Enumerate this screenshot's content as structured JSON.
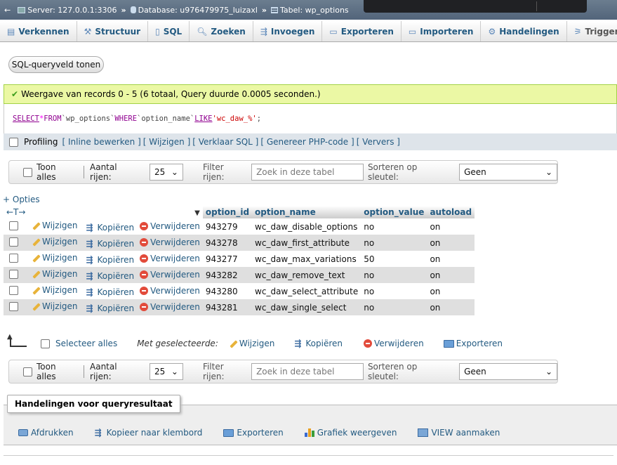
{
  "breadcrumb": {
    "back": "←",
    "server": "Server: 127.0.0.1:3306",
    "database": "Database: u976479975_luizaxl",
    "table": "Tabel: wp_options",
    "separator": "»"
  },
  "tabs": [
    {
      "label": "Verkennen",
      "icon": "browse-icon"
    },
    {
      "label": "Structuur",
      "icon": "structure-icon"
    },
    {
      "label": "SQL",
      "icon": "sql-icon"
    },
    {
      "label": "Zoeken",
      "icon": "search-icon"
    },
    {
      "label": "Invoegen",
      "icon": "insert-icon"
    },
    {
      "label": "Exporteren",
      "icon": "export-icon"
    },
    {
      "label": "Importeren",
      "icon": "import-icon"
    },
    {
      "label": "Handelingen",
      "icon": "wrench-icon"
    },
    {
      "label": "Triggers",
      "icon": "triggers-icon"
    }
  ],
  "sql_button": "SQL-queryveld tonen",
  "success_message": "Weergave van records 0 - 5 (6 totaal, Query duurde 0.0005 seconden.)",
  "query": {
    "select": "SELECT",
    "star": "*",
    "from": "FROM",
    "table": "`wp_options`",
    "where": "WHERE",
    "column": "`option_name`",
    "like": "LIKE",
    "value": "'wc_daw_%'",
    "end": ";"
  },
  "profiling": {
    "label": "Profiling",
    "links": [
      "[ Inline bewerken ]",
      "[ Wijzigen ]",
      "[ Verklaar SQL ]",
      "[ Genereer PHP-code ]",
      "[ Ververs ]"
    ]
  },
  "navbar": {
    "show_all": "Toon alles",
    "rows_label": "Aantal rijen:",
    "rows_value": "25",
    "filter_label": "Filter rijen:",
    "filter_placeholder": "Zoek in deze tabel",
    "sort_label": "Sorteren op sleutel:",
    "sort_value": "Geen"
  },
  "options_link": "+ Opties",
  "column_arrows": "←T→",
  "columns": {
    "sort_indicator": "▼",
    "id": "option_id",
    "name": "option_name",
    "value": "option_value",
    "autoload": "autoload"
  },
  "row_actions": {
    "edit": "Wijzigen",
    "copy": "Kopiëren",
    "delete": "Verwijderen"
  },
  "rows": [
    {
      "id": "943279",
      "name": "wc_daw_disable_options",
      "value": "no",
      "autoload": "on"
    },
    {
      "id": "943278",
      "name": "wc_daw_first_attribute",
      "value": "no",
      "autoload": "on"
    },
    {
      "id": "943277",
      "name": "wc_daw_max_variations",
      "value": "50",
      "autoload": "on"
    },
    {
      "id": "943282",
      "name": "wc_daw_remove_text",
      "value": "no",
      "autoload": "on"
    },
    {
      "id": "943280",
      "name": "wc_daw_select_attribute",
      "value": "no",
      "autoload": "on"
    },
    {
      "id": "943281",
      "name": "wc_daw_single_select",
      "value": "no",
      "autoload": "on"
    }
  ],
  "bulk": {
    "select_all": "Selecteer alles",
    "with_selected": "Met geselecteerde:",
    "edit": "Wijzigen",
    "copy": "Kopiëren",
    "delete": "Verwijderen",
    "export": "Exporteren"
  },
  "query_results": {
    "legend": "Handelingen voor queryresultaat",
    "print": "Afdrukken",
    "copy_clipboard": "Kopieer naar klembord",
    "export": "Exporteren",
    "chart": "Grafiek weergeven",
    "view": "VIEW aanmaken"
  }
}
